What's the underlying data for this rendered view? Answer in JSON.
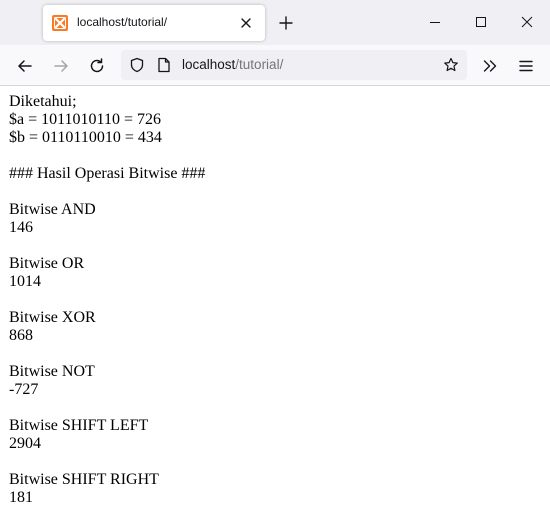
{
  "browser": {
    "tab_title": "localhost/tutorial/",
    "url_host": "localhost",
    "url_path": "/tutorial/"
  },
  "page": {
    "given_heading": "Diketahui;",
    "var_a": "$a = 1011010110 = 726",
    "var_b": "$b = 0110110010 = 434",
    "results_heading": "### Hasil Operasi Bitwise ###",
    "operations": [
      {
        "label": "Bitwise AND",
        "value": "146"
      },
      {
        "label": "Bitwise OR",
        "value": "1014"
      },
      {
        "label": "Bitwise XOR",
        "value": "868"
      },
      {
        "label": "Bitwise NOT",
        "value": "-727"
      },
      {
        "label": "Bitwise SHIFT LEFT",
        "value": "2904"
      },
      {
        "label": "Bitwise SHIFT RIGHT",
        "value": "181"
      }
    ]
  },
  "colors": {
    "xampp_orange": "#fb7a24",
    "chrome_bg": "#f0f0f4",
    "toolbar_bg": "#f9f9fb"
  },
  "icons": {
    "tab_favicon": "xampp-icon",
    "tab_close": "close-icon",
    "new_tab": "plus-icon",
    "back": "arrow-left-icon",
    "forward": "arrow-right-icon",
    "reload": "reload-icon",
    "tracking": "shield-icon",
    "page_info": "page-icon",
    "bookmark": "star-icon",
    "overflow": "chevron-double-right-icon",
    "menu": "hamburger-icon"
  }
}
